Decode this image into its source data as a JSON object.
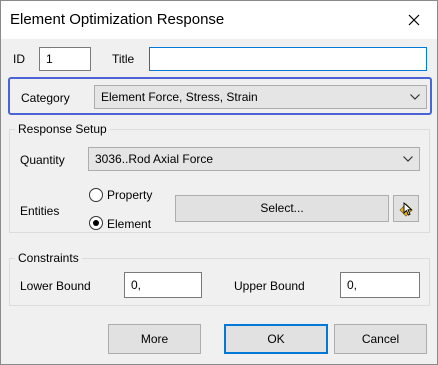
{
  "window": {
    "title": "Element Optimization Response"
  },
  "header": {
    "id_label": "ID",
    "id_value": "1",
    "title_label": "Title",
    "title_value": ""
  },
  "category": {
    "label": "Category",
    "selected": "Element Force, Stress, Strain"
  },
  "response_setup": {
    "legend": "Response Setup",
    "quantity_label": "Quantity",
    "quantity_selected": "3036..Rod Axial Force",
    "entities_label": "Entities",
    "radio_property": "Property",
    "radio_element": "Element",
    "selected_radio": "Element",
    "select_button": "Select..."
  },
  "constraints": {
    "legend": "Constraints",
    "lower_label": "Lower Bound",
    "lower_value": "0,",
    "upper_label": "Upper Bound",
    "upper_value": "0,"
  },
  "buttons": {
    "more": "More",
    "ok": "OK",
    "cancel": "Cancel"
  },
  "colors": {
    "highlight": "#4a64d8",
    "focus": "#0078d7",
    "dialog_bg": "#f0f0f0"
  },
  "icons": {
    "close": "close-icon",
    "chevron": "chevron-down-icon",
    "pick": "pick-cursor-icon"
  }
}
